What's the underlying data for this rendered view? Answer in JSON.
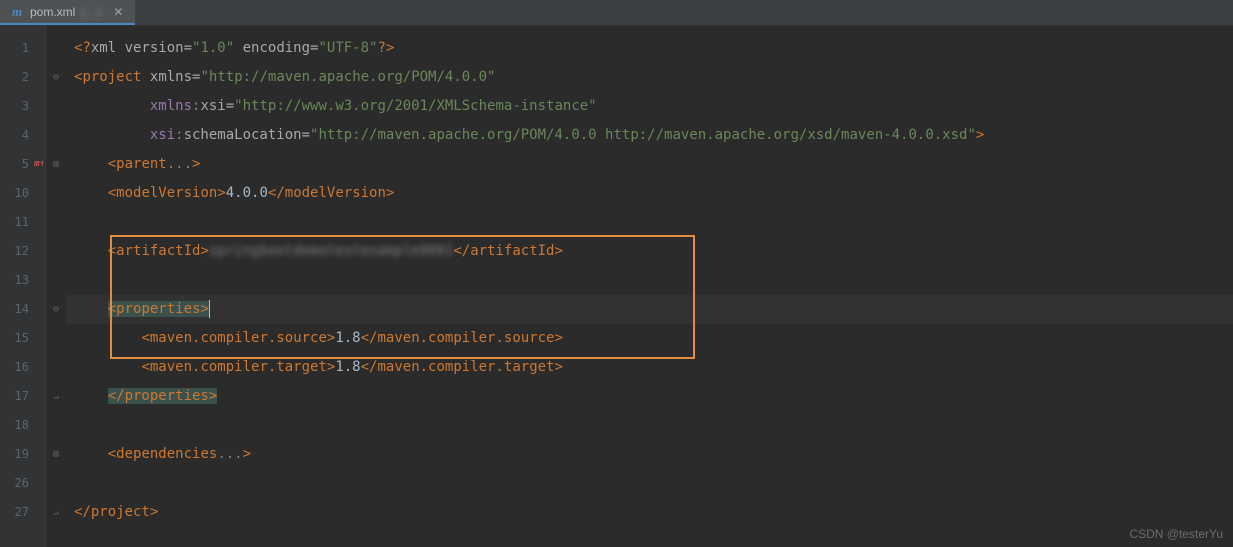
{
  "tab": {
    "icon_label": "m",
    "filename": "pom.xml",
    "context": "(…)"
  },
  "gutter": {
    "lines": [
      "1",
      "2",
      "3",
      "4",
      "5",
      "10",
      "11",
      "12",
      "13",
      "14",
      "15",
      "16",
      "17",
      "18",
      "19",
      "26",
      "27"
    ],
    "mark_row": "5",
    "mark_text": "m↑"
  },
  "fold": {
    "2": "⊖",
    "5": "⊞",
    "14": "⊖",
    "17": "end",
    "19": "⊞",
    "27": "end"
  },
  "code": {
    "l1": {
      "pre": "<?",
      "kw": "xml version",
      "eq1": "=",
      "v1": "\"1.0\"",
      "sp": " ",
      "kw2": "encoding",
      "eq2": "=",
      "v2": "\"UTF-8\"",
      "post": "?>"
    },
    "l2": {
      "open": "<",
      "tag": "project",
      "sp": " ",
      "attr": "xmlns",
      "eq": "=",
      "val": "\"http://maven.apache.org/POM/4.0.0\""
    },
    "l3": {
      "ns": "xmlns:",
      "nsn": "xsi",
      "eq": "=",
      "val": "\"http://www.w3.org/2001/XMLSchema-instance\""
    },
    "l4": {
      "ns": "xsi:",
      "attr": "schemaLocation",
      "eq": "=",
      "val": "\"http://maven.apache.org/POM/4.0.0 http://maven.apache.org/xsd/maven-4.0.0.xsd\"",
      "close": ">"
    },
    "l5": {
      "open": "<",
      "tag": "parent",
      "ell": "...",
      "close": ">"
    },
    "l10": {
      "open": "<",
      "tag": "modelVersion",
      "close1": ">",
      "txt": "4.0.0",
      "open2": "</",
      "tag2": "modelVersion",
      "close2": ">"
    },
    "l12": {
      "open": "<",
      "tag": "artifactId",
      "close1": ">",
      "txt": "…",
      "open2": "</",
      "tag2": "artifactId",
      "close2": ">"
    },
    "l14": {
      "open": "<",
      "tag": "properties",
      "close": ">"
    },
    "l15": {
      "open": "<",
      "tag": "maven.compiler.source",
      "close1": ">",
      "txt": "1.8",
      "open2": "</",
      "tag2": "maven.compiler.source",
      "close2": ">"
    },
    "l16": {
      "open": "<",
      "tag": "maven.compiler.target",
      "close1": ">",
      "txt": "1.8",
      "open2": "</",
      "tag2": "maven.compiler.target",
      "close2": ">"
    },
    "l17": {
      "open": "</",
      "tag": "properties",
      "close": ">"
    },
    "l19": {
      "open": "<",
      "tag": "dependencies",
      "ell": "...",
      "close": ">"
    },
    "l27": {
      "open": "</",
      "tag": "project",
      "close": ">"
    }
  },
  "watermark": "CSDN @testerYu"
}
